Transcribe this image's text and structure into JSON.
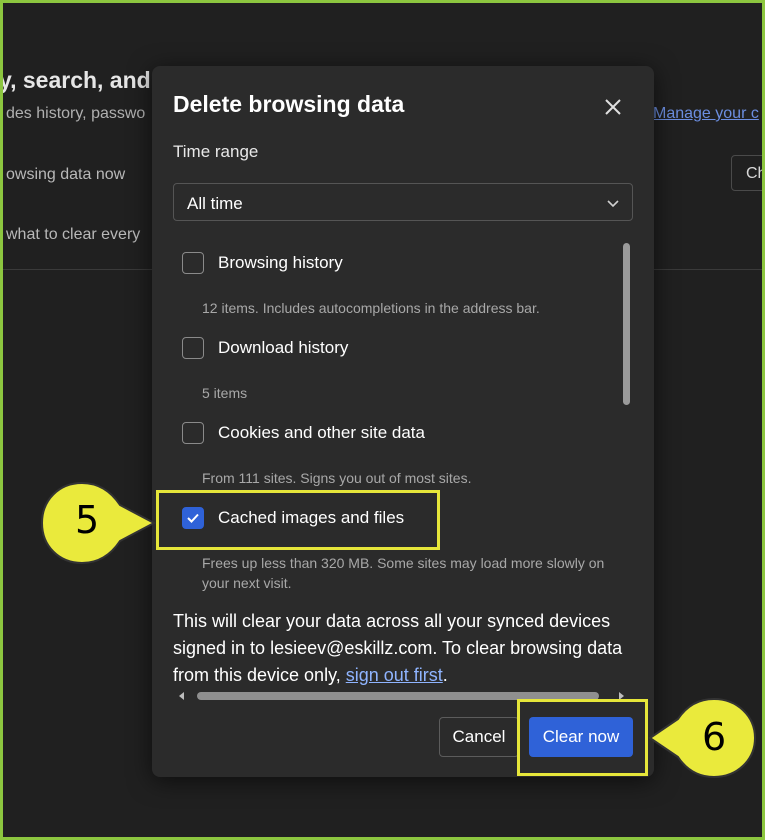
{
  "background": {
    "heading": "y, search, and",
    "subtext": "des history, passwo",
    "manage_link": "Manage your c",
    "row1": "owsing data now",
    "row1_button": "Ch",
    "row2": "what to clear every"
  },
  "dialog": {
    "title": "Delete browsing data",
    "close_icon": "close-icon",
    "time_range_label": "Time range",
    "time_range_value": "All time",
    "options": [
      {
        "label": "Browsing history",
        "checked": false,
        "desc": "12 items. Includes autocompletions in the address bar."
      },
      {
        "label": "Download history",
        "checked": false,
        "desc": "5 items"
      },
      {
        "label": "Cookies and other site data",
        "checked": false,
        "desc": "From 111 sites. Signs you out of most sites."
      },
      {
        "label": "Cached images and files",
        "checked": true,
        "desc": "Frees up less than 320 MB. Some sites may load more slowly on your next visit."
      }
    ],
    "sync_text": "This will clear your data across all your synced devices signed in to lesieev@eskillz.com. To clear browsing data from this device only, ",
    "sync_link": "sign out first",
    "sync_end": ".",
    "cancel_label": "Cancel",
    "clear_label": "Clear now"
  },
  "annotations": {
    "step5": "5",
    "step6": "6",
    "highlight_color": "#e6e63a",
    "callout_color": "#eaea3c"
  },
  "colors": {
    "accent": "#2f62d8",
    "frame_border": "#8cc63f"
  }
}
